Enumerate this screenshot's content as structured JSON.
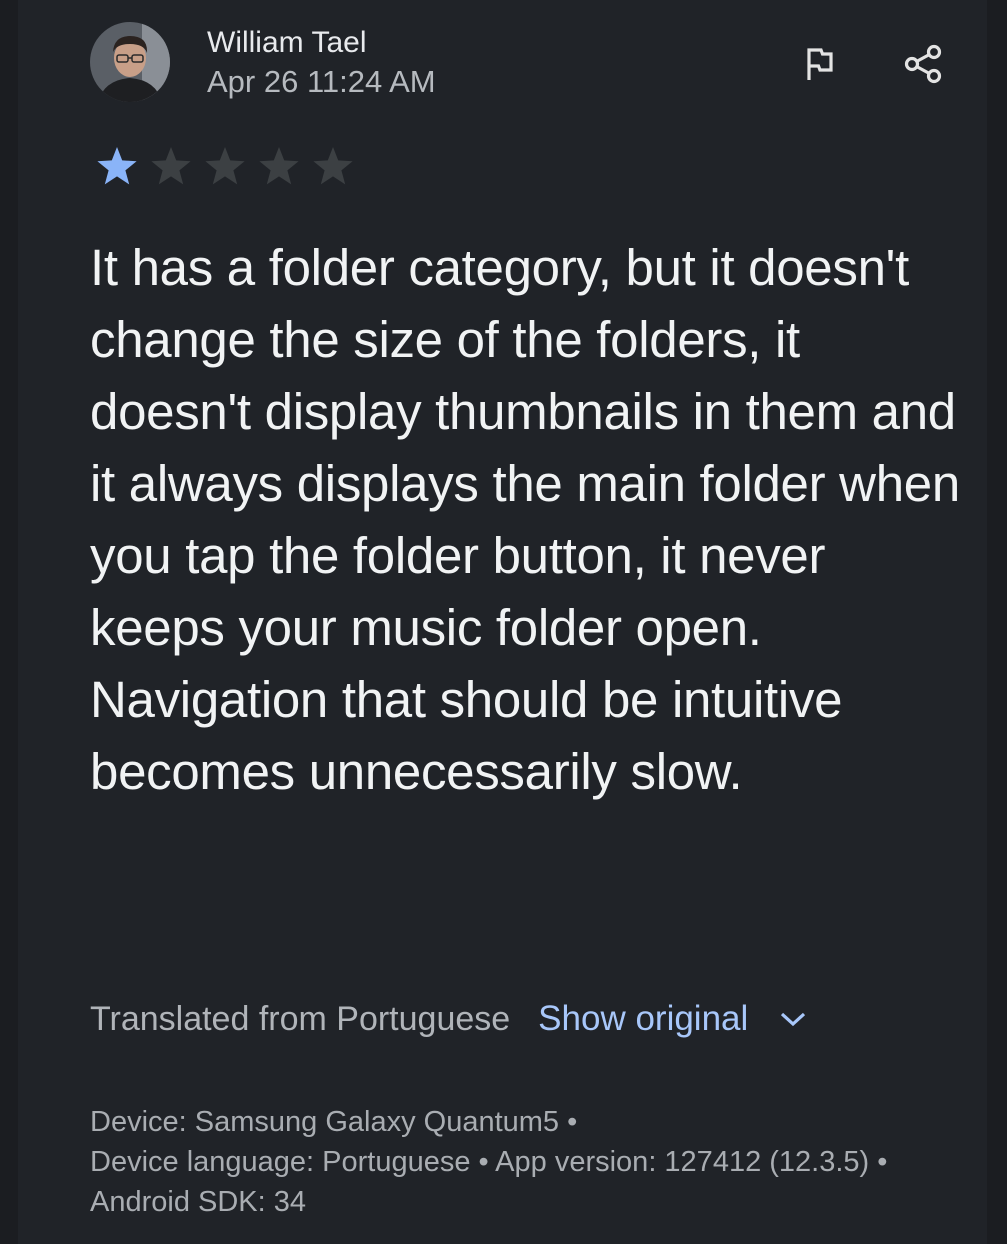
{
  "review": {
    "author": "William Tael",
    "date": "Apr 26 11:24 AM",
    "rating": 1,
    "max_rating": 5,
    "text": "It has a folder category, but it doesn't change the size of the folders, it doesn't display thumbnails in them and it always displays the main folder when you tap the folder button, it never keeps your music folder open. Navigation that should be intuitive becomes unnecessarily slow.",
    "translated_label": "Translated from Portuguese",
    "show_original_label": "Show original"
  },
  "device": {
    "device": "Device: Samsung Galaxy Quantum5",
    "language": "Device language: Portuguese",
    "app_version": "App version: 127412 (12.3.5)",
    "sdk": "Android SDK: 34",
    "separator": "•"
  },
  "icons": {
    "flag": "flag-icon",
    "share": "share-icon",
    "chevron": "chevron-down-icon"
  },
  "colors": {
    "background": "#202328",
    "star_filled": "#8ab4f8",
    "star_empty": "#3c4043",
    "link": "#a8c7fa"
  }
}
